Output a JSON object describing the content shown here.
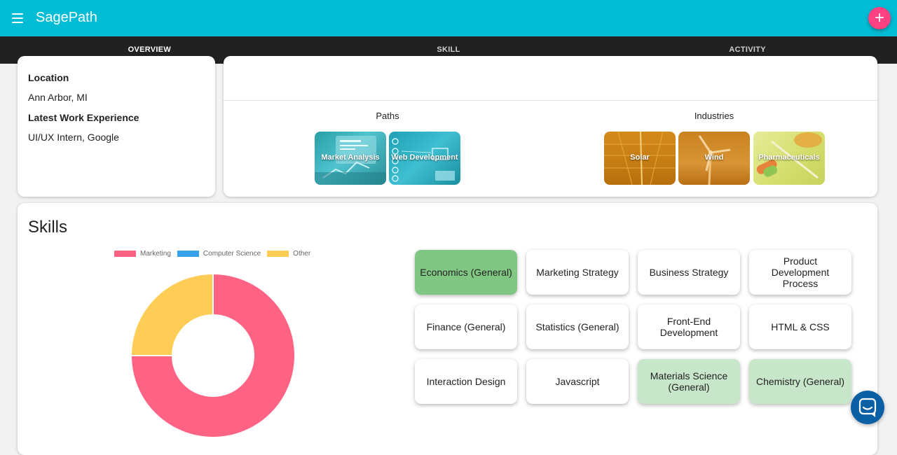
{
  "app": {
    "title": "SagePath"
  },
  "fab": {
    "label": "+"
  },
  "tabs": [
    {
      "label": "OVERVIEW"
    },
    {
      "label": "SKILL"
    },
    {
      "label": "ACTIVITY"
    }
  ],
  "profile": {
    "location_label": "Location",
    "location_value": "Ann Arbor, MI",
    "work_label": "Latest Work Experience",
    "work_value": "UI/UX Intern, Google"
  },
  "paths": {
    "title": "Paths",
    "items": [
      {
        "label": "Market Analysis"
      },
      {
        "label": "Web Development"
      }
    ]
  },
  "industries": {
    "title": "Industries",
    "items": [
      {
        "label": "Solar"
      },
      {
        "label": "Wind"
      },
      {
        "label": "Pharmaceuticals"
      }
    ]
  },
  "skills": {
    "title": "Skills",
    "chips": [
      {
        "label": "Economics (General)",
        "style": "green-dark"
      },
      {
        "label": "Marketing Strategy",
        "style": ""
      },
      {
        "label": "Business Strategy",
        "style": ""
      },
      {
        "label": "Product Development Process",
        "style": ""
      },
      {
        "label": "Finance (General)",
        "style": ""
      },
      {
        "label": "Statistics (General)",
        "style": ""
      },
      {
        "label": "Front-End Development",
        "style": ""
      },
      {
        "label": "HTML & CSS",
        "style": ""
      },
      {
        "label": "Interaction Design",
        "style": ""
      },
      {
        "label": "Javascript",
        "style": ""
      },
      {
        "label": "Materials Science (General)",
        "style": "green-light"
      },
      {
        "label": "Chemistry (General)",
        "style": "green-light"
      }
    ]
  },
  "colors": {
    "appbar": "#00bcd4",
    "fab": "#ff4081",
    "marketing": "#ff6384",
    "computer_science": "#36a2eb",
    "other": "#ffcd56"
  },
  "chart_data": {
    "type": "pie",
    "categories": [
      "Marketing",
      "Computer Science",
      "Other"
    ],
    "values": [
      75,
      0,
      25
    ],
    "legend": "top"
  }
}
